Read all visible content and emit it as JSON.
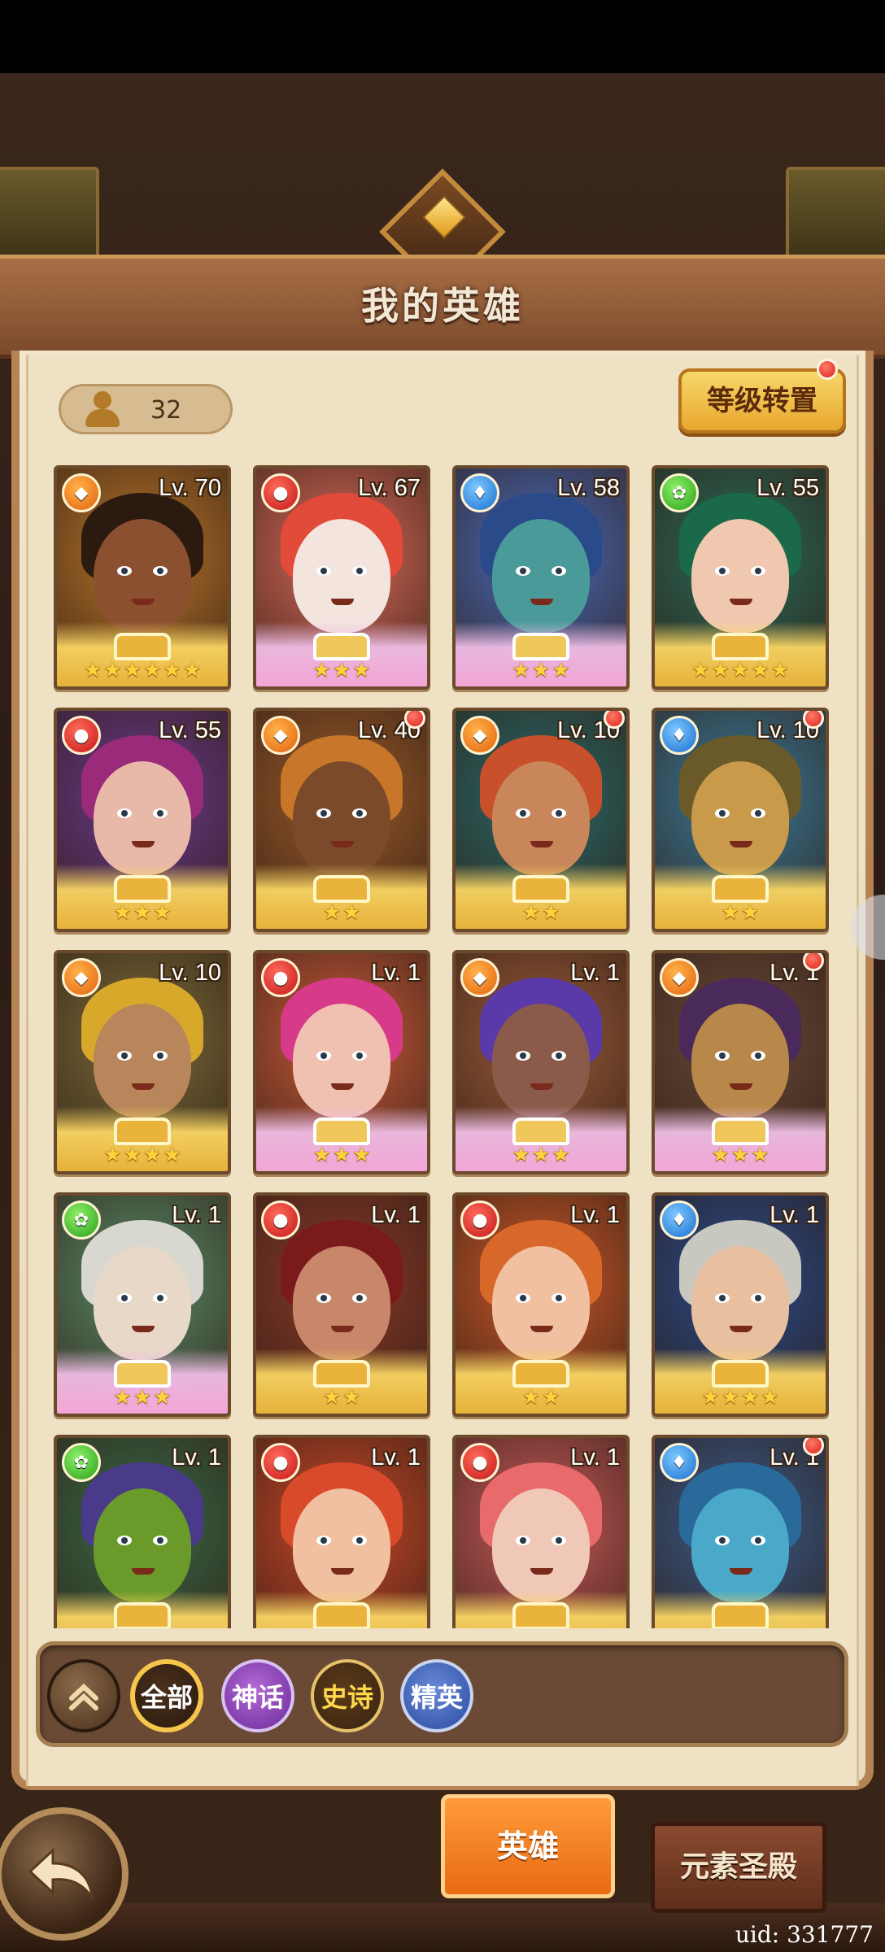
{
  "header": {
    "title": "我的英雄"
  },
  "hero_count": "32",
  "level_reset": {
    "label": "等级转置"
  },
  "heroes": [
    {
      "level": "Lv. 70",
      "element": "fire",
      "stars": 6,
      "rarity": "epic",
      "dot": false,
      "skin": "#8a5030",
      "hair": "#2a1a10",
      "bg": "#b8742a"
    },
    {
      "level": "Lv. 67",
      "element": "blood",
      "stars": 3,
      "rarity": "myth",
      "dot": false,
      "skin": "#f3e4de",
      "hair": "#e24a3a",
      "bg": "#d86a5a"
    },
    {
      "level": "Lv. 58",
      "element": "water",
      "stars": 3,
      "rarity": "myth",
      "dot": false,
      "skin": "#4a9a9a",
      "hair": "#2a4a8a",
      "bg": "#4a6ab8"
    },
    {
      "level": "Lv. 55",
      "element": "wind",
      "stars": 5,
      "rarity": "epic",
      "dot": false,
      "skin": "#f0c8b0",
      "hair": "#1a6a4a",
      "bg": "#2a6a5a"
    },
    {
      "level": "Lv. 55",
      "element": "blood",
      "stars": 3,
      "rarity": "epic",
      "dot": false,
      "skin": "#e8b8a8",
      "hair": "#9a2a7a",
      "bg": "#6a3a8a"
    },
    {
      "level": "Lv. 40",
      "element": "fire",
      "stars": 2,
      "rarity": "epic",
      "dot": true,
      "skin": "#7a4a2a",
      "hair": "#c8762a",
      "bg": "#9a5a2a"
    },
    {
      "level": "Lv. 10",
      "element": "fire",
      "stars": 2,
      "rarity": "epic",
      "dot": true,
      "skin": "#c8865a",
      "hair": "#c8502a",
      "bg": "#2a6a6a"
    },
    {
      "level": "Lv. 10",
      "element": "water",
      "stars": 2,
      "rarity": "epic",
      "dot": true,
      "skin": "#c89a4a",
      "hair": "#6a5a2a",
      "bg": "#3a7a9a"
    },
    {
      "level": "Lv. 10",
      "element": "fire",
      "stars": 4,
      "rarity": "epic",
      "dot": false,
      "skin": "#b8865a",
      "hair": "#d8a82a",
      "bg": "#7a6a3a"
    },
    {
      "level": "Lv. 1",
      "element": "blood",
      "stars": 3,
      "rarity": "myth",
      "dot": false,
      "skin": "#f0c0b0",
      "hair": "#d83a8a",
      "bg": "#c85a3a"
    },
    {
      "level": "Lv. 1",
      "element": "fire",
      "stars": 3,
      "rarity": "myth",
      "dot": false,
      "skin": "#8a5a4a",
      "hair": "#5a3aa8",
      "bg": "#9a5a3a"
    },
    {
      "level": "Lv. 1",
      "element": "fire",
      "stars": 3,
      "rarity": "myth",
      "dot": true,
      "skin": "#b8884a",
      "hair": "#4a2a5a",
      "bg": "#6a4a3a"
    },
    {
      "level": "Lv. 1",
      "element": "wind",
      "stars": 3,
      "rarity": "myth",
      "dot": false,
      "skin": "#e8d8c8",
      "hair": "#d8d8d0",
      "bg": "#5a8a6a"
    },
    {
      "level": "Lv. 1",
      "element": "blood",
      "stars": 2,
      "rarity": "epic",
      "dot": false,
      "skin": "#c8866a",
      "hair": "#7a1a1a",
      "bg": "#8a3a2a"
    },
    {
      "level": "Lv. 1",
      "element": "blood",
      "stars": 2,
      "rarity": "epic",
      "dot": false,
      "skin": "#f0c0a0",
      "hair": "#d8682a",
      "bg": "#c8582a"
    },
    {
      "level": "Lv. 1",
      "element": "water",
      "stars": 4,
      "rarity": "epic",
      "dot": false,
      "skin": "#e8c0a0",
      "hair": "#c8c8c0",
      "bg": "#2a4a8a"
    },
    {
      "level": "Lv. 1",
      "element": "wind",
      "stars": 0,
      "rarity": "epic",
      "dot": false,
      "skin": "#6a9a2a",
      "hair": "#4a3a8a",
      "bg": "#3a6a4a"
    },
    {
      "level": "Lv. 1",
      "element": "blood",
      "stars": 0,
      "rarity": "epic",
      "dot": false,
      "skin": "#f0c0a0",
      "hair": "#d84a2a",
      "bg": "#c8482a"
    },
    {
      "level": "Lv. 1",
      "element": "blood",
      "stars": 0,
      "rarity": "epic",
      "dot": false,
      "skin": "#f0c8b8",
      "hair": "#e86a6a",
      "bg": "#c85a5a"
    },
    {
      "level": "Lv. 1",
      "element": "water",
      "stars": 0,
      "rarity": "epic",
      "dot": true,
      "skin": "#4aa8c8",
      "hair": "#2a6a9a",
      "bg": "#3a5a8a"
    }
  ],
  "filters": {
    "all": "全部",
    "myth": "神话",
    "epic": "史诗",
    "elite": "精英"
  },
  "icons": {
    "collapse": "double-chevron-up-icon",
    "back": "back-arrow-icon",
    "element_fire": "fire-element-icon",
    "element_blood": "blood-element-icon",
    "element_water": "water-element-icon",
    "element_wind": "wind-element-icon"
  },
  "tabs": {
    "hero": "英雄",
    "element_temple": "元素圣殿"
  },
  "uid": "uid: 331777",
  "colors": {
    "accent": "#e86a12",
    "notify": "#d8231a",
    "star": "#ffd23c"
  }
}
